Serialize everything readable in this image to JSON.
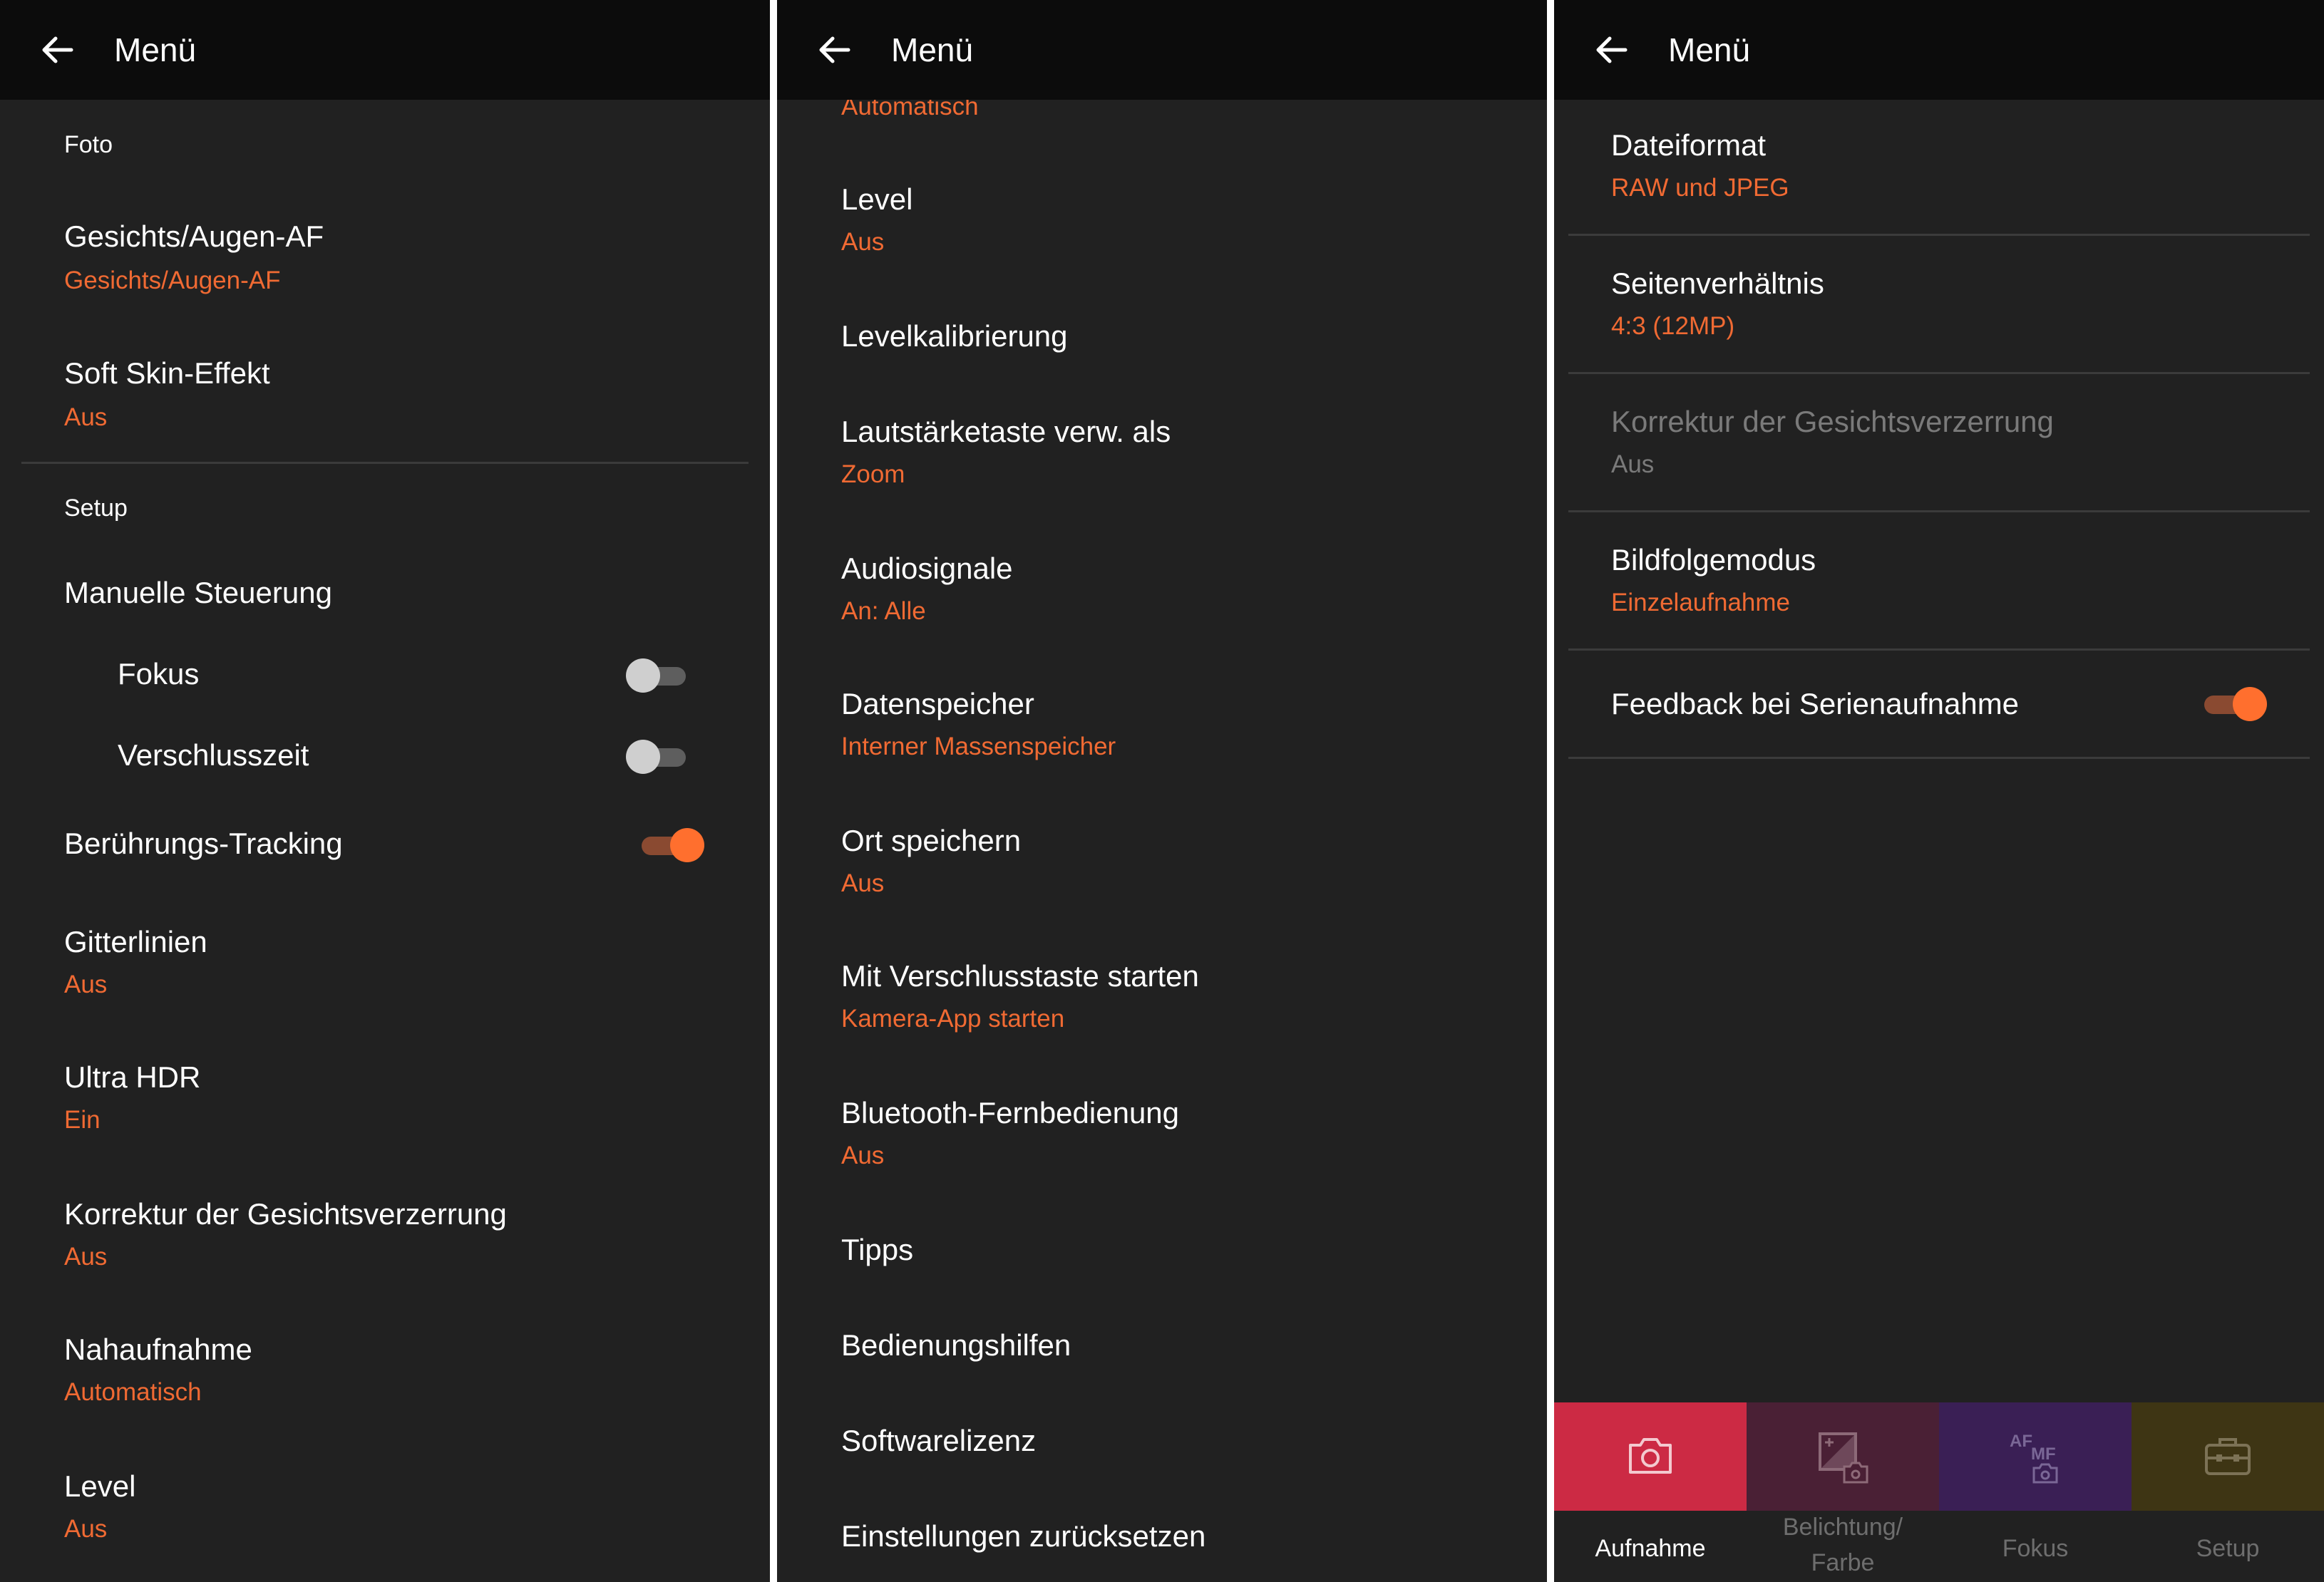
{
  "colors": {
    "background": "#212121",
    "app_bar": "#0c0c0c",
    "accent": "#f06a33",
    "nav_aufnahme": "#cc2a44",
    "nav_belichtung": "#4a2035",
    "nav_fokus": "#3a1f55",
    "nav_setup": "#3e3514"
  },
  "panel1": {
    "title": "Menü",
    "section_foto": "Foto",
    "items": [
      {
        "label": "Gesichts/Augen-AF",
        "value": "Gesichts/Augen-AF"
      },
      {
        "label": "Soft Skin-Effekt",
        "value": "Aus"
      }
    ],
    "section_setup": "Setup",
    "manual_control": "Manuelle Steuerung",
    "fokus": {
      "label": "Fokus",
      "toggle": false
    },
    "verschlusszeit": {
      "label": "Verschlusszeit",
      "toggle": false
    },
    "touch_tracking": {
      "label": "Berührungs-Tracking",
      "toggle": true
    },
    "items2": [
      {
        "label": "Gitterlinien",
        "value": "Aus"
      },
      {
        "label": "Ultra HDR",
        "value": "Ein"
      },
      {
        "label": "Korrektur der Gesichtsverzerrung",
        "value": "Aus"
      },
      {
        "label": "Nahaufnahme",
        "value": "Automatisch"
      },
      {
        "label": "Level",
        "value": "Aus"
      }
    ]
  },
  "panel2": {
    "title": "Menü",
    "partial_value": "Automatisch",
    "items": [
      {
        "label": "Level",
        "value": "Aus"
      },
      {
        "label": "Levelkalibrierung",
        "value": ""
      },
      {
        "label": "Lautstärketaste verw. als",
        "value": "Zoom"
      },
      {
        "label": "Audiosignale",
        "value": "An: Alle"
      },
      {
        "label": "Datenspeicher",
        "value": "Interner Massenspeicher"
      },
      {
        "label": "Ort speichern",
        "value": "Aus"
      },
      {
        "label": "Mit Verschlusstaste starten",
        "value": "Kamera-App starten"
      },
      {
        "label": "Bluetooth-Fernbedienung",
        "value": "Aus"
      },
      {
        "label": "Tipps",
        "value": ""
      },
      {
        "label": "Bedienungshilfen",
        "value": ""
      },
      {
        "label": "Softwarelizenz",
        "value": ""
      },
      {
        "label": "Einstellungen zurücksetzen",
        "value": ""
      }
    ]
  },
  "panel3": {
    "title": "Menü",
    "items": [
      {
        "label": "Dateiformat",
        "value": "RAW und JPEG"
      },
      {
        "label": "Seitenverhältnis",
        "value": "4:3 (12MP)"
      },
      {
        "label": "Korrektur der Gesichtsverzerrung",
        "value": "Aus",
        "disabled": true
      },
      {
        "label": "Bildfolgemodus",
        "value": "Einzelaufnahme"
      }
    ],
    "feedback": {
      "label": "Feedback bei Serienaufnahme",
      "toggle": true
    },
    "nav": [
      {
        "label": "Aufnahme",
        "icon": "camera-icon",
        "active": true
      },
      {
        "label": "Belichtung/ Farbe",
        "icon": "exposure-camera-icon",
        "active": false
      },
      {
        "label": "Fokus",
        "icon": "af-mf-camera-icon",
        "active": false
      },
      {
        "label": "Setup",
        "icon": "toolbox-icon",
        "active": false
      }
    ]
  }
}
